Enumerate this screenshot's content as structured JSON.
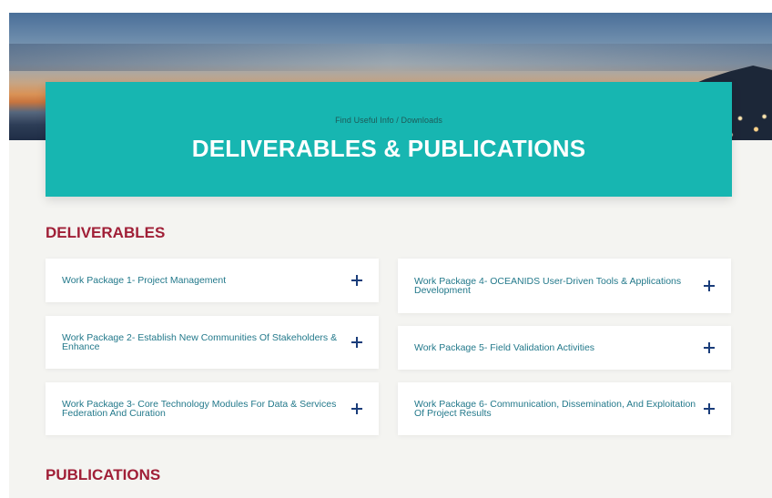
{
  "header": {
    "breadcrumb": "Find Useful Info / Downloads",
    "title": "DELIVERABLES & PUBLICATIONS"
  },
  "deliverables": {
    "heading": "DELIVERABLES",
    "left": [
      {
        "label": "Work Package 1- Project Management",
        "icon": "plus-icon"
      },
      {
        "label": "Work Package 2- Establish New Communities Of Stakeholders & Enhance",
        "icon": "plus-icon"
      },
      {
        "label": "Work Package 3- Core Technology Modules For Data & Services Federation And Curation",
        "icon": "plus-icon"
      }
    ],
    "right": [
      {
        "label": "Work Package 4- OCEANIDS User-Driven Tools & Applications Development",
        "icon": "plus-icon"
      },
      {
        "label": "Work Package 5- Field Validation Activities",
        "icon": "plus-icon"
      },
      {
        "label": "Work Package 6- Communication, Dissemination, And Exploitation Of Project Results",
        "icon": "plus-icon"
      }
    ]
  },
  "publications": {
    "heading": "PUBLICATIONS"
  },
  "colors": {
    "banner": "#17b6b1",
    "heading": "#a01f37",
    "card_text": "#23798b",
    "plus": "#1a3d7a"
  }
}
